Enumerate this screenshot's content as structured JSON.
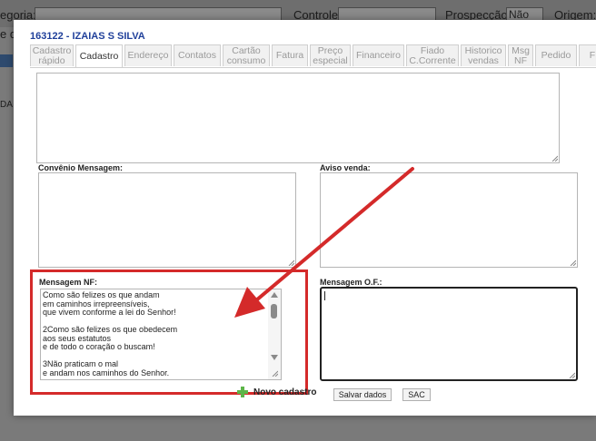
{
  "background": {
    "categoria_label": "egoria:",
    "controle_label": "Controle:",
    "prospeccao_label": "Prospecção:",
    "prospeccao_value": "Não",
    "origem_label": "Origem:",
    "left_fragment_1": "e d",
    "left_fragment_2": "DA S"
  },
  "modal": {
    "title": "163122 - IZAIAS S SILVA",
    "tabs": [
      {
        "label": "Cadastro rápido"
      },
      {
        "label": "Cadastro"
      },
      {
        "label": "Endereço"
      },
      {
        "label": "Contatos"
      },
      {
        "label": "Cartão consumo"
      },
      {
        "label": "Fatura"
      },
      {
        "label": "Preço especial"
      },
      {
        "label": "Financeiro"
      },
      {
        "label": "Fiado C.Corrente"
      },
      {
        "label": "Historico vendas"
      },
      {
        "label": "Msg NF"
      },
      {
        "label": "Pedido"
      },
      {
        "label": "F"
      }
    ],
    "active_tab": "Cadastro",
    "convenio_label": "Convênio Mensagem:",
    "aviso_label": "Aviso venda:",
    "mensagem_nf_label": "Mensagem NF:",
    "mensagem_of_label": "Mensagem O.F.:",
    "mensagem_nf_lines": [
      "Como são felizes os que andam",
      "em caminhos irrepreensíveis,",
      "que vivem conforme a lei do Senhor!",
      "",
      "2Como são felizes os que obedecem",
      "aos seus estatutos",
      "e de todo o coração o buscam!",
      "",
      "3Não praticam o mal",
      "e andam nos caminhos do Senhor."
    ],
    "buttons": {
      "novo_cadastro": "Novo cadastro",
      "salvar_dados": "Salvar dados",
      "sac": "SAC"
    }
  },
  "colors": {
    "highlight": "#d42a2a",
    "title": "#1f3f9a",
    "plus": "#5cb548"
  }
}
